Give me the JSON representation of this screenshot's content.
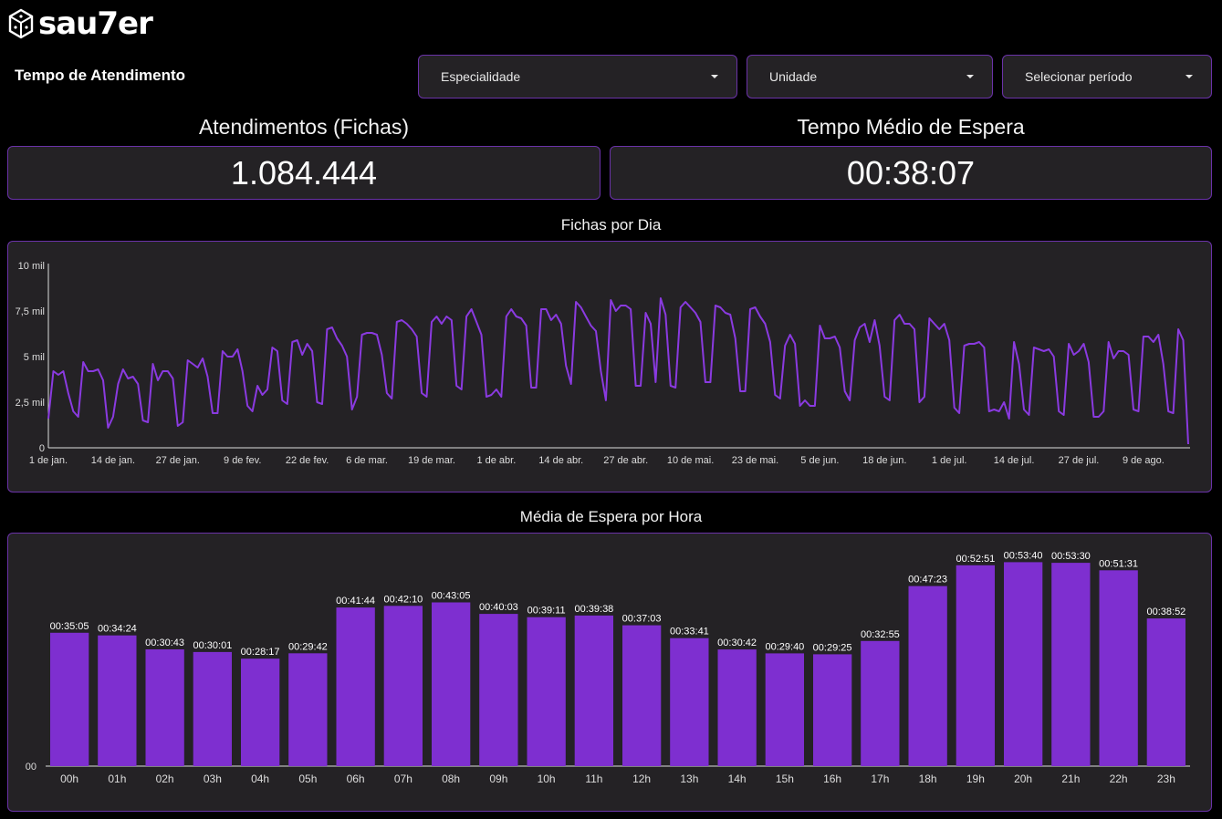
{
  "app": {
    "logo_text": "sau7er",
    "logo_icon": "dice-icon"
  },
  "page": {
    "title": "Tempo de Atendimento"
  },
  "filters": {
    "especialidade": "Especialidade",
    "unidade": "Unidade",
    "periodo": "Selecionar período"
  },
  "kpis": {
    "atendimentos_label": "Atendimentos (Fichas)",
    "atendimentos_value": "1.084.444",
    "espera_label": "Tempo Médio de Espera",
    "espera_value": "00:38:07"
  },
  "colors": {
    "accent": "#7e2fd0",
    "border": "#6a32a8",
    "panel": "#242225",
    "line": "#8a3ae0"
  },
  "chart_data": [
    {
      "type": "line",
      "title": "Fichas por Dia",
      "yticks": [
        {
          "v": 0,
          "label": "0"
        },
        {
          "v": 2500,
          "label": "2,5 mil"
        },
        {
          "v": 5000,
          "label": "5 mil"
        },
        {
          "v": 7500,
          "label": "7,5 mil"
        },
        {
          "v": 10000,
          "label": "10 mil"
        }
      ],
      "ylim": [
        0,
        10000
      ],
      "xticks": [
        {
          "day": 0,
          "label": "1 de jan."
        },
        {
          "day": 13,
          "label": "14 de jan."
        },
        {
          "day": 26,
          "label": "27 de jan."
        },
        {
          "day": 39,
          "label": "9 de fev."
        },
        {
          "day": 52,
          "label": "22 de fev."
        },
        {
          "day": 64,
          "label": "6 de mar."
        },
        {
          "day": 77,
          "label": "19 de mar."
        },
        {
          "day": 90,
          "label": "1 de abr."
        },
        {
          "day": 103,
          "label": "14 de abr."
        },
        {
          "day": 116,
          "label": "27 de abr."
        },
        {
          "day": 129,
          "label": "10 de mai."
        },
        {
          "day": 142,
          "label": "23 de mai."
        },
        {
          "day": 155,
          "label": "5 de jun."
        },
        {
          "day": 168,
          "label": "18 de jun."
        },
        {
          "day": 181,
          "label": "1 de jul."
        },
        {
          "day": 194,
          "label": "14 de jul."
        },
        {
          "day": 207,
          "label": "27 de jul."
        },
        {
          "day": 220,
          "label": "9 de ago."
        }
      ],
      "values": [
        1600,
        4200,
        4000,
        4200,
        3000,
        2000,
        1700,
        4700,
        4200,
        4200,
        4300,
        3700,
        1100,
        1700,
        3500,
        4300,
        3800,
        3900,
        3500,
        1500,
        1400,
        4600,
        3700,
        4200,
        4200,
        3800,
        1200,
        1400,
        4800,
        4600,
        4400,
        4900,
        3900,
        1900,
        1900,
        5300,
        5000,
        5000,
        5400,
        4200,
        2300,
        2000,
        3400,
        2900,
        3200,
        5500,
        5300,
        2600,
        2400,
        5800,
        5900,
        5100,
        5700,
        5300,
        2500,
        2400,
        6500,
        6600,
        6000,
        5600,
        5000,
        2100,
        2800,
        6200,
        6300,
        6300,
        6200,
        5100,
        3000,
        2700,
        6900,
        7000,
        6800,
        6500,
        6100,
        3000,
        2800,
        6900,
        7200,
        6800,
        7200,
        7000,
        3400,
        3200,
        7200,
        7600,
        6900,
        6200,
        2800,
        2900,
        3200,
        2800,
        7200,
        7600,
        7200,
        7100,
        6700,
        3300,
        3300,
        7600,
        7600,
        7000,
        7300,
        6800,
        4500,
        3500,
        8000,
        7700,
        7200,
        6700,
        6400,
        4200,
        2600,
        8100,
        7500,
        7800,
        7800,
        7600,
        3400,
        3400,
        7400,
        6800,
        3600,
        8200,
        7300,
        3400,
        3300,
        7700,
        8000,
        7700,
        7400,
        6900,
        3600,
        3600,
        7800,
        7700,
        7400,
        7300,
        6000,
        3100,
        3100,
        7600,
        7700,
        7200,
        6800,
        5800,
        2900,
        2700,
        5600,
        6200,
        5700,
        2300,
        2600,
        2300,
        2300,
        6700,
        6000,
        6000,
        6100,
        5500,
        3100,
        2600,
        5900,
        6600,
        6800,
        5800,
        7000,
        5600,
        2800,
        2600,
        7000,
        7300,
        6800,
        6800,
        6500,
        2500,
        2800,
        7100,
        6800,
        6500,
        6800,
        5900,
        2200,
        1900,
        5600,
        5700,
        5700,
        5800,
        5500,
        2000,
        2100,
        2000,
        2500,
        1600,
        5800,
        4600,
        2100,
        1800,
        5500,
        5400,
        5300,
        5400,
        5000,
        2000,
        1800,
        5700,
        5100,
        5300,
        5700,
        4700,
        1700,
        1700,
        2000,
        5800,
        4900,
        5300,
        5300,
        5100,
        2100,
        2000,
        6100,
        6100,
        5800,
        6200,
        4600,
        2000,
        1900,
        6500,
        5900,
        200
      ]
    },
    {
      "type": "bar",
      "title": "Média de Espera por Hora",
      "ytick_label": "00",
      "ylim": [
        0,
        3600
      ],
      "categories": [
        "00h",
        "01h",
        "02h",
        "03h",
        "04h",
        "05h",
        "06h",
        "07h",
        "08h",
        "09h",
        "10h",
        "11h",
        "12h",
        "13h",
        "14h",
        "15h",
        "16h",
        "17h",
        "18h",
        "19h",
        "20h",
        "21h",
        "22h",
        "23h"
      ],
      "labels": [
        "00:35:05",
        "00:34:24",
        "00:30:43",
        "00:30:01",
        "00:28:17",
        "00:29:42",
        "00:41:44",
        "00:42:10",
        "00:43:05",
        "00:40:03",
        "00:39:11",
        "00:39:38",
        "00:37:03",
        "00:33:41",
        "00:30:42",
        "00:29:40",
        "00:29:25",
        "00:32:55",
        "00:47:23",
        "00:52:51",
        "00:53:40",
        "00:53:30",
        "00:51:31",
        "00:38:52"
      ],
      "values": [
        2105,
        2064,
        1843,
        1801,
        1697,
        1782,
        2504,
        2530,
        2585,
        2403,
        2351,
        2378,
        2223,
        2021,
        1842,
        1780,
        1765,
        1975,
        2843,
        3171,
        3220,
        3210,
        3091,
        2332
      ]
    }
  ]
}
